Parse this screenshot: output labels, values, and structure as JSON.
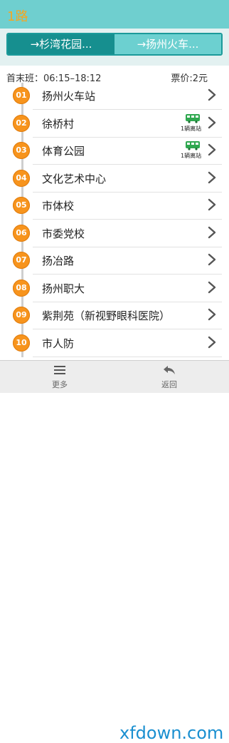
{
  "header": {
    "title": "1路"
  },
  "directions": {
    "active": "→杉湾花园...",
    "inactive": "→扬州火车..."
  },
  "info": {
    "times": "首末班：06:15–18:12",
    "fare": "票价:2元"
  },
  "stops": [
    {
      "num": "01",
      "name": "扬州火车站"
    },
    {
      "num": "02",
      "name": "徐桥村",
      "bus": "1辆离站"
    },
    {
      "num": "03",
      "name": "体育公园",
      "bus": "1辆离站"
    },
    {
      "num": "04",
      "name": "文化艺术中心"
    },
    {
      "num": "05",
      "name": "市体校"
    },
    {
      "num": "06",
      "name": "市委党校"
    },
    {
      "num": "07",
      "name": "扬冶路"
    },
    {
      "num": "08",
      "name": "扬州职大"
    },
    {
      "num": "09",
      "name": "紫荆苑（新视野眼科医院）"
    },
    {
      "num": "10",
      "name": "市人防"
    }
  ],
  "bottom": {
    "more": "更多",
    "back": "返回",
    "watermark": "xfdown.com"
  },
  "colors": {
    "header": "#6fcfcf",
    "accent": "#168f8f",
    "stop_badge": "#f7941d",
    "title_text": "#f5a623"
  }
}
